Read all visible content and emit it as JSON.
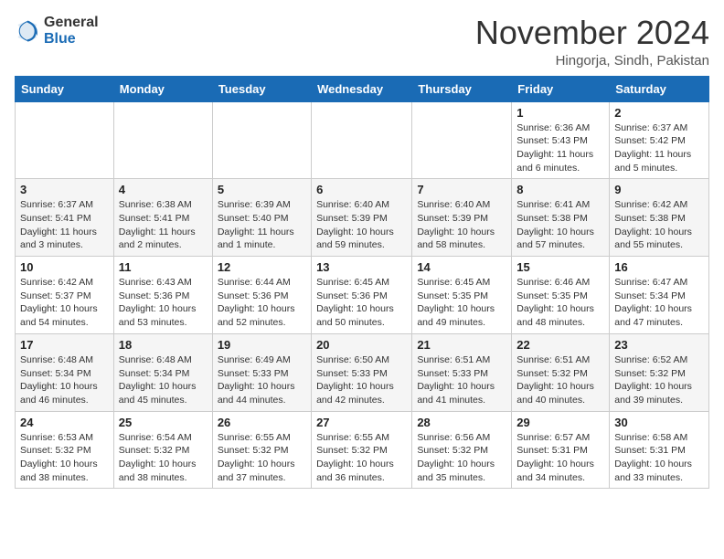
{
  "header": {
    "logo_line1": "General",
    "logo_line2": "Blue",
    "month_title": "November 2024",
    "subtitle": "Hingorja, Sindh, Pakistan"
  },
  "days_of_week": [
    "Sunday",
    "Monday",
    "Tuesday",
    "Wednesday",
    "Thursday",
    "Friday",
    "Saturday"
  ],
  "weeks": [
    [
      {
        "day": "",
        "info": ""
      },
      {
        "day": "",
        "info": ""
      },
      {
        "day": "",
        "info": ""
      },
      {
        "day": "",
        "info": ""
      },
      {
        "day": "",
        "info": ""
      },
      {
        "day": "1",
        "info": "Sunrise: 6:36 AM\nSunset: 5:43 PM\nDaylight: 11 hours and 6 minutes."
      },
      {
        "day": "2",
        "info": "Sunrise: 6:37 AM\nSunset: 5:42 PM\nDaylight: 11 hours and 5 minutes."
      }
    ],
    [
      {
        "day": "3",
        "info": "Sunrise: 6:37 AM\nSunset: 5:41 PM\nDaylight: 11 hours and 3 minutes."
      },
      {
        "day": "4",
        "info": "Sunrise: 6:38 AM\nSunset: 5:41 PM\nDaylight: 11 hours and 2 minutes."
      },
      {
        "day": "5",
        "info": "Sunrise: 6:39 AM\nSunset: 5:40 PM\nDaylight: 11 hours and 1 minute."
      },
      {
        "day": "6",
        "info": "Sunrise: 6:40 AM\nSunset: 5:39 PM\nDaylight: 10 hours and 59 minutes."
      },
      {
        "day": "7",
        "info": "Sunrise: 6:40 AM\nSunset: 5:39 PM\nDaylight: 10 hours and 58 minutes."
      },
      {
        "day": "8",
        "info": "Sunrise: 6:41 AM\nSunset: 5:38 PM\nDaylight: 10 hours and 57 minutes."
      },
      {
        "day": "9",
        "info": "Sunrise: 6:42 AM\nSunset: 5:38 PM\nDaylight: 10 hours and 55 minutes."
      }
    ],
    [
      {
        "day": "10",
        "info": "Sunrise: 6:42 AM\nSunset: 5:37 PM\nDaylight: 10 hours and 54 minutes."
      },
      {
        "day": "11",
        "info": "Sunrise: 6:43 AM\nSunset: 5:36 PM\nDaylight: 10 hours and 53 minutes."
      },
      {
        "day": "12",
        "info": "Sunrise: 6:44 AM\nSunset: 5:36 PM\nDaylight: 10 hours and 52 minutes."
      },
      {
        "day": "13",
        "info": "Sunrise: 6:45 AM\nSunset: 5:36 PM\nDaylight: 10 hours and 50 minutes."
      },
      {
        "day": "14",
        "info": "Sunrise: 6:45 AM\nSunset: 5:35 PM\nDaylight: 10 hours and 49 minutes."
      },
      {
        "day": "15",
        "info": "Sunrise: 6:46 AM\nSunset: 5:35 PM\nDaylight: 10 hours and 48 minutes."
      },
      {
        "day": "16",
        "info": "Sunrise: 6:47 AM\nSunset: 5:34 PM\nDaylight: 10 hours and 47 minutes."
      }
    ],
    [
      {
        "day": "17",
        "info": "Sunrise: 6:48 AM\nSunset: 5:34 PM\nDaylight: 10 hours and 46 minutes."
      },
      {
        "day": "18",
        "info": "Sunrise: 6:48 AM\nSunset: 5:34 PM\nDaylight: 10 hours and 45 minutes."
      },
      {
        "day": "19",
        "info": "Sunrise: 6:49 AM\nSunset: 5:33 PM\nDaylight: 10 hours and 44 minutes."
      },
      {
        "day": "20",
        "info": "Sunrise: 6:50 AM\nSunset: 5:33 PM\nDaylight: 10 hours and 42 minutes."
      },
      {
        "day": "21",
        "info": "Sunrise: 6:51 AM\nSunset: 5:33 PM\nDaylight: 10 hours and 41 minutes."
      },
      {
        "day": "22",
        "info": "Sunrise: 6:51 AM\nSunset: 5:32 PM\nDaylight: 10 hours and 40 minutes."
      },
      {
        "day": "23",
        "info": "Sunrise: 6:52 AM\nSunset: 5:32 PM\nDaylight: 10 hours and 39 minutes."
      }
    ],
    [
      {
        "day": "24",
        "info": "Sunrise: 6:53 AM\nSunset: 5:32 PM\nDaylight: 10 hours and 38 minutes."
      },
      {
        "day": "25",
        "info": "Sunrise: 6:54 AM\nSunset: 5:32 PM\nDaylight: 10 hours and 38 minutes."
      },
      {
        "day": "26",
        "info": "Sunrise: 6:55 AM\nSunset: 5:32 PM\nDaylight: 10 hours and 37 minutes."
      },
      {
        "day": "27",
        "info": "Sunrise: 6:55 AM\nSunset: 5:32 PM\nDaylight: 10 hours and 36 minutes."
      },
      {
        "day": "28",
        "info": "Sunrise: 6:56 AM\nSunset: 5:32 PM\nDaylight: 10 hours and 35 minutes."
      },
      {
        "day": "29",
        "info": "Sunrise: 6:57 AM\nSunset: 5:31 PM\nDaylight: 10 hours and 34 minutes."
      },
      {
        "day": "30",
        "info": "Sunrise: 6:58 AM\nSunset: 5:31 PM\nDaylight: 10 hours and 33 minutes."
      }
    ]
  ]
}
